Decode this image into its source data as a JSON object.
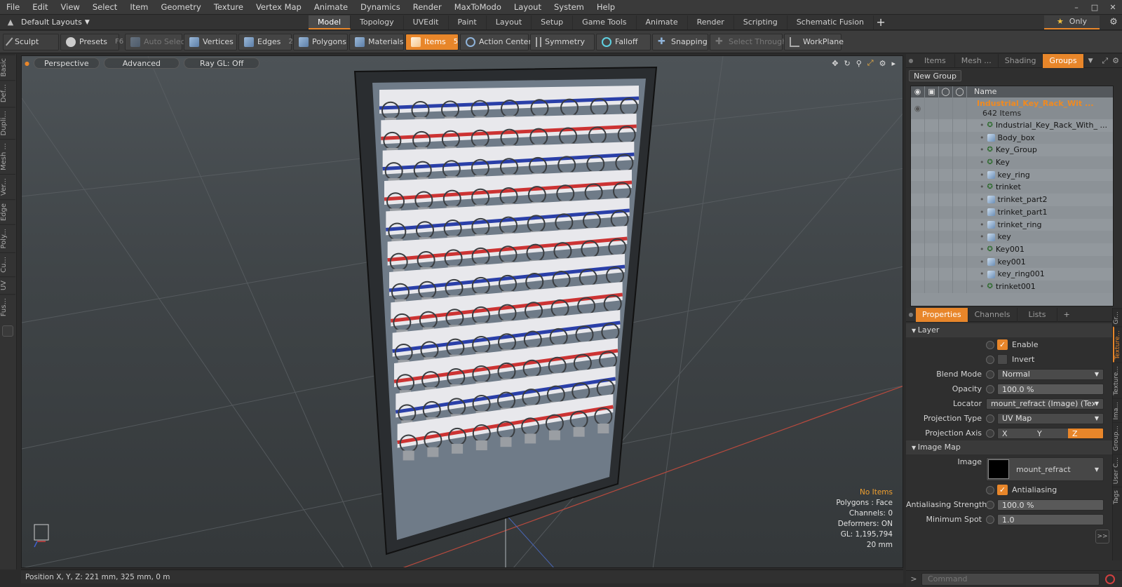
{
  "menu": [
    "File",
    "Edit",
    "View",
    "Select",
    "Item",
    "Geometry",
    "Texture",
    "Vertex Map",
    "Animate",
    "Dynamics",
    "Render",
    "MaxToModo",
    "Layout",
    "System",
    "Help"
  ],
  "layout_selector": "Default Layouts",
  "layout_tabs": [
    "Model",
    "Topology",
    "UVEdit",
    "Paint",
    "Layout",
    "Setup",
    "Game Tools",
    "Animate",
    "Render",
    "Scripting",
    "Schematic Fusion"
  ],
  "active_layout_tab": "Model",
  "only_label": "Only",
  "toolbar": {
    "sculpt": "Sculpt",
    "presets": "Presets",
    "presets_key": "F6",
    "auto_select": "Auto Select",
    "vertices": "Vertices",
    "vertices_key": "1",
    "edges": "Edges",
    "edges_key": "2",
    "polygons": "Polygons",
    "materials": "Materials",
    "items": "Items",
    "items_key": "5",
    "action_center": "Action Center",
    "symmetry": "Symmetry",
    "falloff": "Falloff",
    "snapping": "Snapping",
    "select_through": "Select Through",
    "workplane": "WorkPlane"
  },
  "left_tabs": [
    "Basic",
    "Def...",
    "Dupli...",
    "Mesh ...",
    "Ver...",
    "Edge",
    "Poly...",
    "Cu...",
    "UV",
    "Fus..."
  ],
  "viewport": {
    "perspective": "Perspective",
    "advanced": "Advanced",
    "raygl": "Ray GL: Off",
    "info": {
      "no_items": "No Items",
      "polygons": "Polygons : Face",
      "channels": "Channels: 0",
      "deformers": "Deformers: ON",
      "gl": "GL: 1,195,794",
      "scale": "20 mm"
    }
  },
  "status": "Position X, Y, Z:   221 mm, 325 mm, 0 m",
  "right_tabs": [
    "Items",
    "Mesh ...",
    "Shading",
    "Groups"
  ],
  "active_right_tab": "Groups",
  "new_group": "New Group",
  "list_header": "Name",
  "group_root": {
    "name": "Industrial_Key_Rack_Wit ...",
    "count": "642 Items"
  },
  "items": [
    {
      "name": "Industrial_Key_Rack_With_ ...",
      "icon": "locator"
    },
    {
      "name": "Body_box",
      "icon": "mesh"
    },
    {
      "name": "Key_Group",
      "icon": "locator"
    },
    {
      "name": "Key",
      "icon": "locator"
    },
    {
      "name": "key_ring",
      "icon": "mesh"
    },
    {
      "name": "trinket",
      "icon": "locator"
    },
    {
      "name": "trinket_part2",
      "icon": "mesh"
    },
    {
      "name": "trinket_part1",
      "icon": "mesh"
    },
    {
      "name": "trinket_ring",
      "icon": "mesh"
    },
    {
      "name": "key",
      "icon": "mesh"
    },
    {
      "name": "Key001",
      "icon": "locator"
    },
    {
      "name": "key001",
      "icon": "mesh"
    },
    {
      "name": "key_ring001",
      "icon": "mesh"
    },
    {
      "name": "trinket001",
      "icon": "locator"
    }
  ],
  "prop_tabs": [
    "Properties",
    "Channels",
    "Lists"
  ],
  "props": {
    "layer": "Layer",
    "enable": "Enable",
    "invert": "Invert",
    "blend_mode_label": "Blend Mode",
    "blend_mode": "Normal",
    "opacity_label": "Opacity",
    "opacity": "100.0 %",
    "locator_label": "Locator",
    "locator": "mount_refract (Image) (Text ...",
    "projection_type_label": "Projection Type",
    "projection_type": "UV Map",
    "projection_axis_label": "Projection Axis",
    "axes": [
      "X",
      "Y",
      "Z"
    ],
    "active_axis": "Z",
    "image_map": "Image Map",
    "image_label": "Image",
    "image": "mount_refract",
    "antialiasing": "Antialiasing",
    "aa_strength_label": "Antialiasing Strength",
    "aa_strength": "100.0 %",
    "min_spot_label": "Minimum Spot",
    "min_spot": "1.0"
  },
  "prop_side_tabs": [
    "Gr...",
    "Texture...",
    "Texture...",
    "Ima...",
    "Group...",
    "User C...",
    "Tags"
  ],
  "command_placeholder": "Command",
  "colors": {
    "accent": "#e8862a"
  }
}
